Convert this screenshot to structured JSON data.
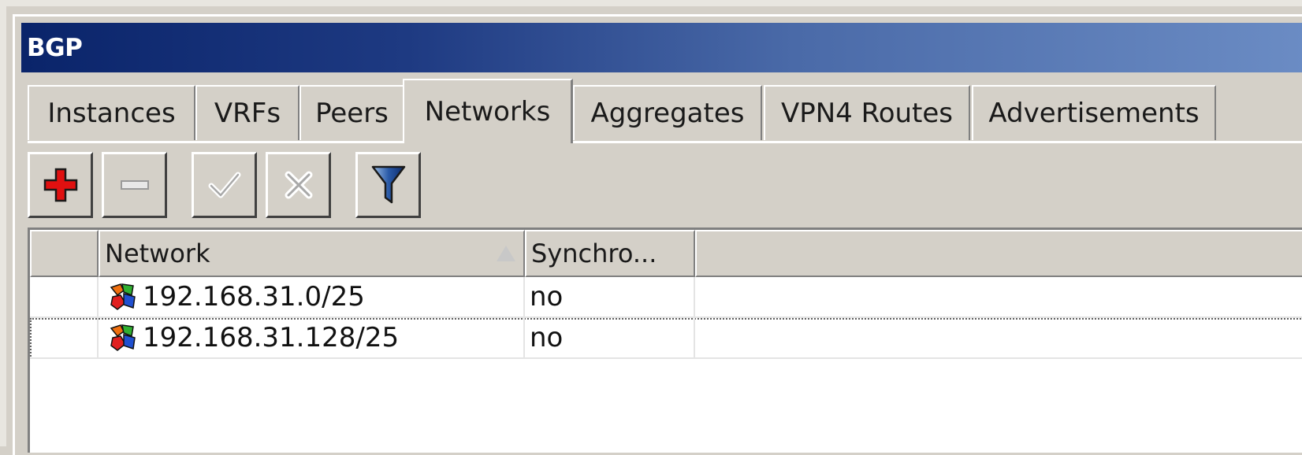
{
  "window": {
    "title": "BGP"
  },
  "tabs": [
    {
      "label": "Instances",
      "active": false
    },
    {
      "label": "VRFs",
      "active": false
    },
    {
      "label": "Peers",
      "active": false
    },
    {
      "label": "Networks",
      "active": true
    },
    {
      "label": "Aggregates",
      "active": false
    },
    {
      "label": "VPN4 Routes",
      "active": false
    },
    {
      "label": "Advertisements",
      "active": false
    }
  ],
  "toolbar": {
    "buttons": [
      {
        "name": "add",
        "icon": "plus-icon",
        "enabled": true
      },
      {
        "name": "remove",
        "icon": "minus-icon",
        "enabled": true
      },
      {
        "name": "enable",
        "icon": "check-icon",
        "enabled": false
      },
      {
        "name": "disable",
        "icon": "x-icon",
        "enabled": false
      },
      {
        "name": "filter",
        "icon": "filter-icon",
        "enabled": true
      }
    ]
  },
  "table": {
    "columns": [
      {
        "label": ""
      },
      {
        "label": "Network",
        "sorted": "ascending"
      },
      {
        "label": "Synchro..."
      },
      {
        "label": ""
      }
    ],
    "rows": [
      {
        "network": "192.168.31.0/25",
        "synchronize": "no",
        "icon": "network-puzzle-icon"
      },
      {
        "network": "192.168.31.128/25",
        "synchronize": "no",
        "icon": "network-puzzle-icon"
      }
    ]
  },
  "colors": {
    "titlebar_start": "#0a246a",
    "titlebar_end": "#6b8cc4",
    "plus_red": "#e01010",
    "window_bg": "#d4d0c8"
  }
}
